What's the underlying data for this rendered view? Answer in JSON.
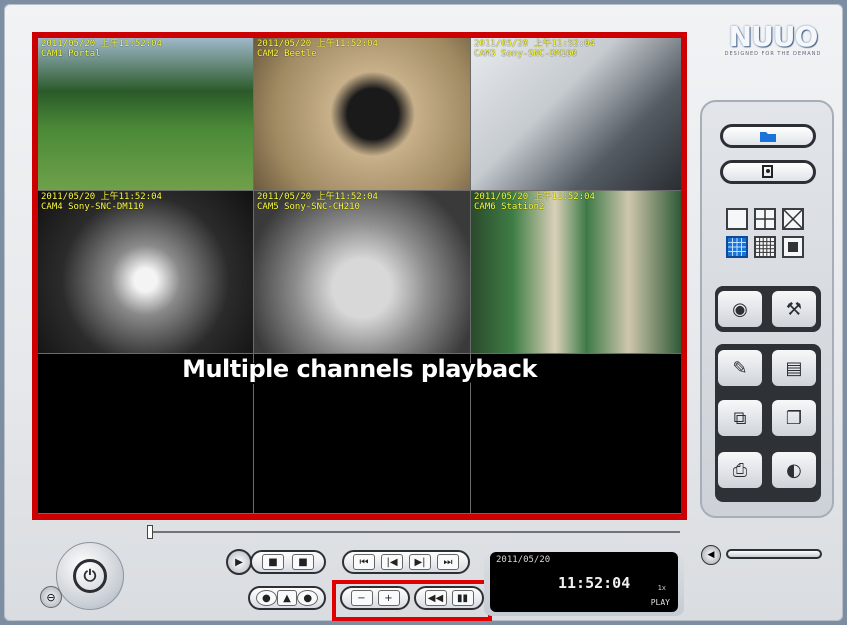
{
  "logo": {
    "mark": "NUUO",
    "tagline": "DESIGNED FOR THE DEMAND"
  },
  "overlay_text": "Multiple channels playback",
  "channels": [
    {
      "ts": "2011/05/20 上午11:52:04",
      "cam": "CAM1 Portal"
    },
    {
      "ts": "2011/05/20 上午11:52:04",
      "cam": "CAM2 Beetle"
    },
    {
      "ts": "2011/05/20 上午11:52:04",
      "cam": "CAM3 Sony-SNC-DM160"
    },
    {
      "ts": "2011/05/20 上午11:52:04",
      "cam": "CAM4 Sony-SNC-DM110"
    },
    {
      "ts": "2011/05/20 上午11:52:04",
      "cam": "CAM5 Sony-SNC-CH210"
    },
    {
      "ts": "2011/05/20 上午11:52:04",
      "cam": "CAM6 Station2"
    }
  ],
  "status": {
    "date": "2011/05/20",
    "time": "11:52:04",
    "speed": "1x",
    "mode": "PLAY"
  },
  "right_panel": {
    "top_buttons": [
      {
        "icon": "folder-icon"
      },
      {
        "icon": "search-icon"
      }
    ],
    "layouts": [
      "1x1",
      "2x2",
      "3x3-diag",
      "4x4",
      "5x5",
      "custom"
    ],
    "selected_layout": "4x4",
    "tools": [
      "pen-icon",
      "file-icon",
      "export-icon",
      "snapshot-icon",
      "print-icon",
      "eye-icon"
    ]
  },
  "controls": {
    "play_group": [
      "▶",
      "■",
      "■"
    ],
    "step_group": [
      "⏮",
      "|◀",
      "▶|",
      "⏭"
    ],
    "zoom_group": [
      "−",
      "+"
    ],
    "speed_group": [
      "◀◀",
      "▮▮"
    ],
    "aux_group": [
      "●",
      "▲",
      "●"
    ],
    "power_label": "⏻"
  },
  "colors": {
    "highlight": "#e00000",
    "caption": "#ffff3a",
    "selected": "#1a73d9"
  }
}
